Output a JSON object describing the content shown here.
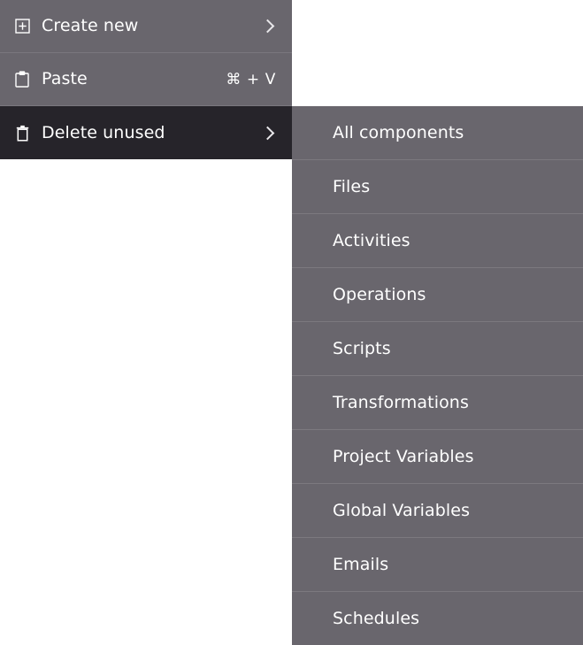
{
  "context_menu": {
    "items": [
      {
        "label": "Create new",
        "icon": "add-square-icon",
        "shortcut": "",
        "has_submenu": true,
        "selected": false
      },
      {
        "label": "Paste",
        "icon": "clipboard-icon",
        "shortcut": "⌘ + V",
        "has_submenu": false,
        "selected": false
      },
      {
        "label": "Delete unused",
        "icon": "trash-icon",
        "shortcut": "",
        "has_submenu": true,
        "selected": true
      }
    ]
  },
  "submenu": {
    "items": [
      {
        "label": "All components"
      },
      {
        "label": "Files"
      },
      {
        "label": "Activities"
      },
      {
        "label": "Operations"
      },
      {
        "label": "Scripts"
      },
      {
        "label": "Transformations"
      },
      {
        "label": "Project Variables"
      },
      {
        "label": "Global Variables"
      },
      {
        "label": "Emails"
      },
      {
        "label": "Schedules"
      }
    ]
  },
  "colors": {
    "menu_background": "#69666D",
    "selected_background": "#26242A",
    "divider": "#7c797f",
    "text": "#ffffff",
    "page_background": "#ffffff"
  }
}
